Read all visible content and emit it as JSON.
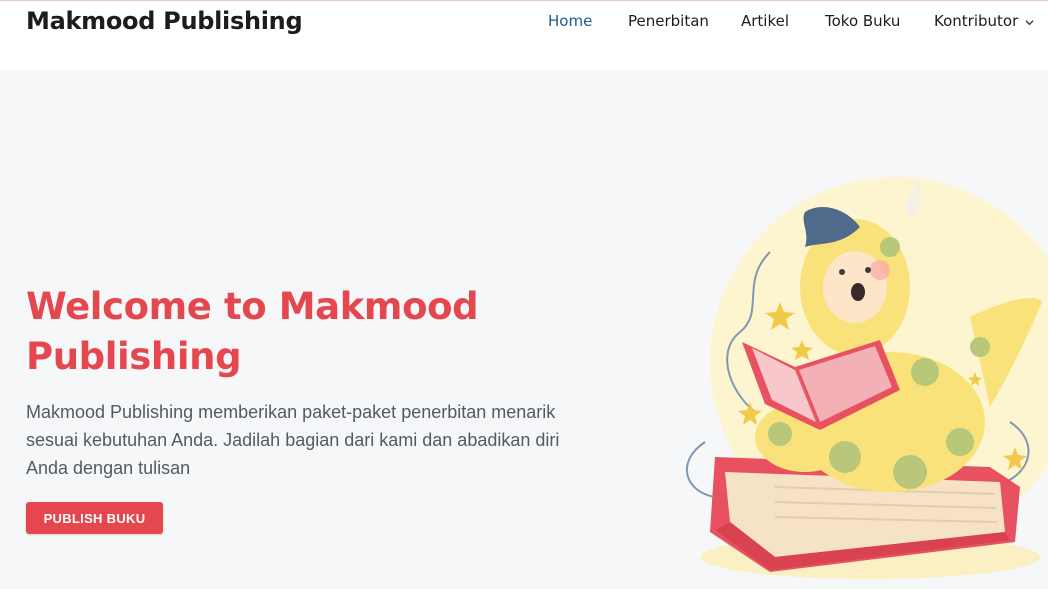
{
  "header": {
    "brand": "Makmood Publishing",
    "nav": [
      {
        "label": "Home",
        "active": true
      },
      {
        "label": "Penerbitan",
        "active": false
      },
      {
        "label": "Artikel",
        "active": false
      },
      {
        "label": "Toko Buku",
        "active": false
      },
      {
        "label": "Kontributor",
        "active": false,
        "has_dropdown": true
      }
    ]
  },
  "hero": {
    "title": "Welcome to Makmood Publishing",
    "description": "Makmood Publishing memberikan paket-paket penerbitan menarik sesuai kebutuhan Anda. Jadilah bagian dari kami dan abadikan diri Anda dengan tulisan",
    "cta_label": "PUBLISH BUKU",
    "illustration": "child-in-dinosaur-costume-reading-book-illustration"
  },
  "colors": {
    "accent": "#e5474e",
    "nav_active": "#1e5b8c",
    "background": "#f6f7f9",
    "header_bg": "#ffffff"
  }
}
